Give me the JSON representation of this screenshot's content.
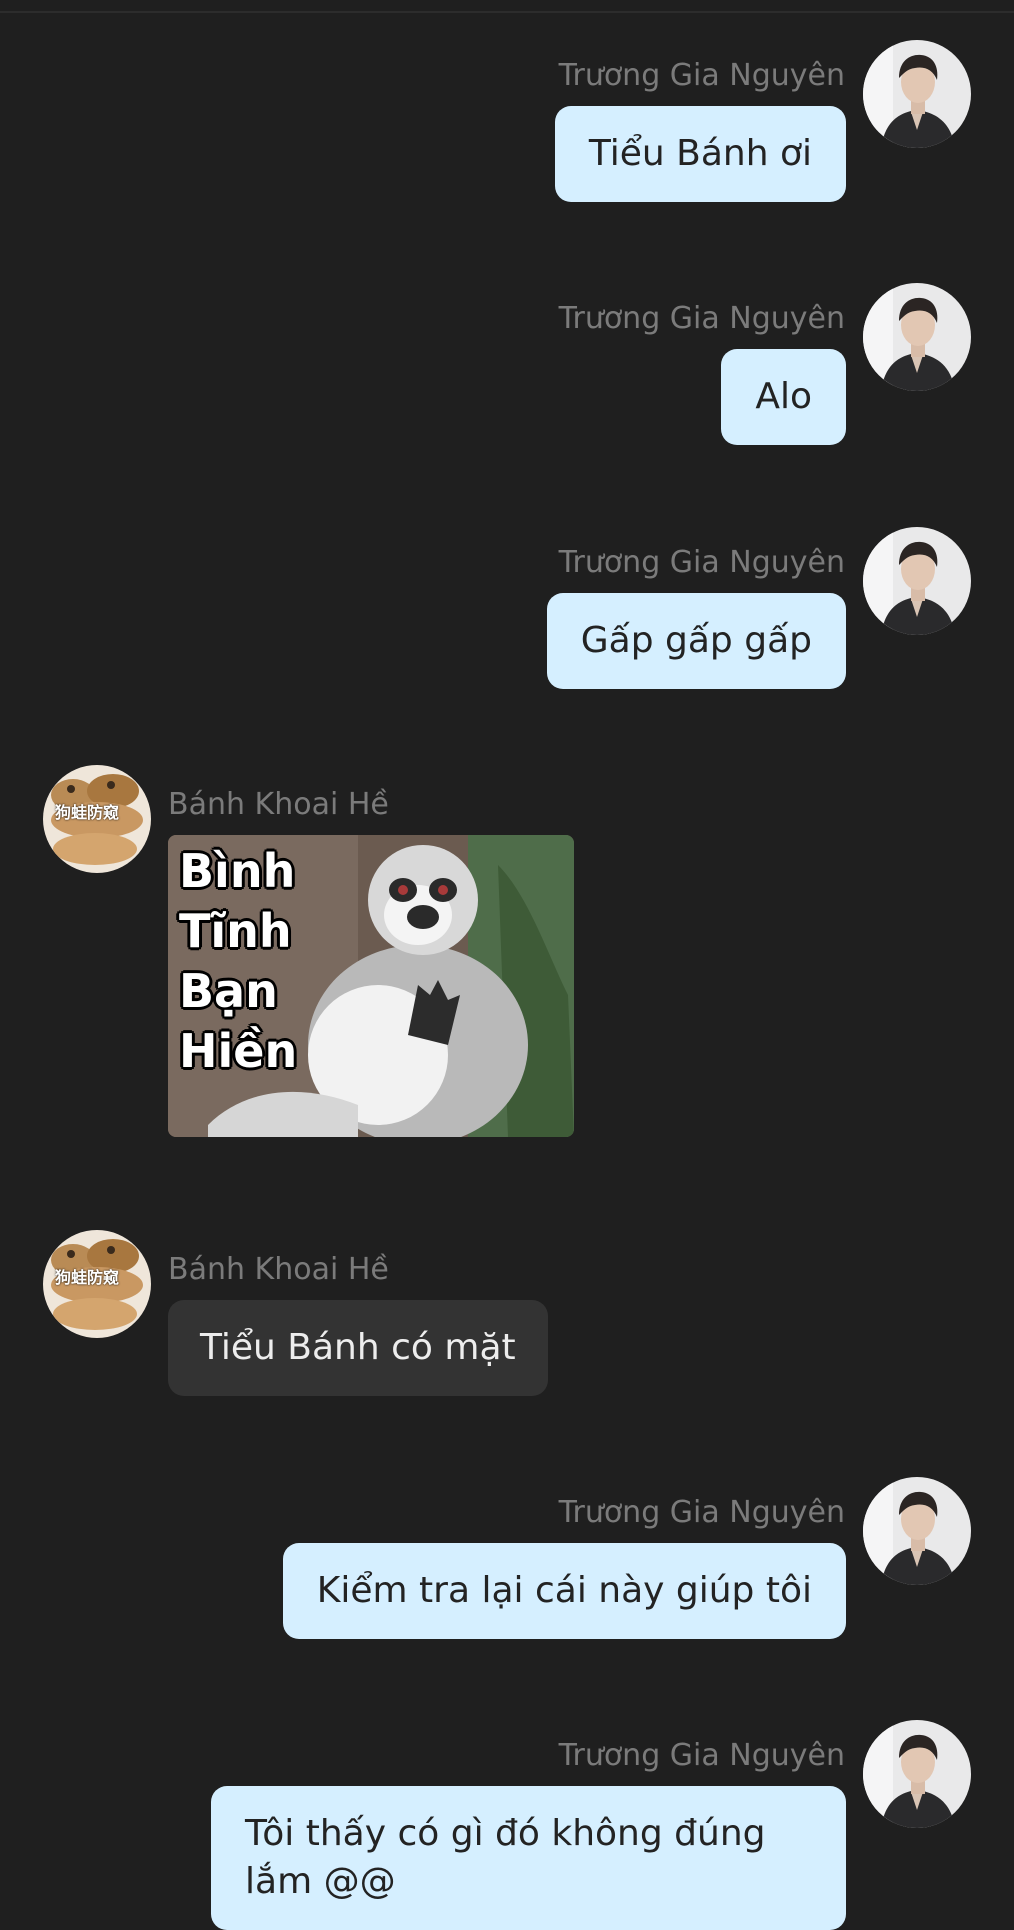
{
  "colors": {
    "background": "#1f1f1f",
    "outgoing_bubble": "#d5efff",
    "incoming_bubble": "#333333",
    "sender_name": "#7b7b7b"
  },
  "messages": [
    {
      "side": "right",
      "sender": "Trương Gia Nguyên",
      "text": "Tiểu Bánh ơi",
      "avatar": "man-portrait-avatar"
    },
    {
      "side": "right",
      "sender": "Trương Gia Nguyên",
      "text": "Alo",
      "avatar": "man-portrait-avatar"
    },
    {
      "side": "right",
      "sender": "Trương Gia Nguyên",
      "text": "Gấp gấp gấp",
      "avatar": "man-portrait-avatar"
    },
    {
      "side": "left",
      "sender": "Bánh Khoai Hề",
      "sticker_lines": [
        "Bình",
        "Tĩnh",
        "Bạn",
        "Hiền"
      ],
      "avatar": "bread-buns-avatar",
      "avatar_text": "狗蛙防窥"
    },
    {
      "side": "left",
      "sender": "Bánh Khoai Hề",
      "text": "Tiểu Bánh có mặt",
      "avatar": "bread-buns-avatar",
      "avatar_text": "狗蛙防窥"
    },
    {
      "side": "right",
      "sender": "Trương Gia Nguyên",
      "text": "Kiểm tra lại cái này giúp tôi",
      "avatar": "man-portrait-avatar"
    },
    {
      "side": "right",
      "sender": "Trương Gia Nguyên",
      "text": "Tôi thấy có gì đó không đúng lắm @@",
      "avatar": "man-portrait-avatar"
    }
  ]
}
